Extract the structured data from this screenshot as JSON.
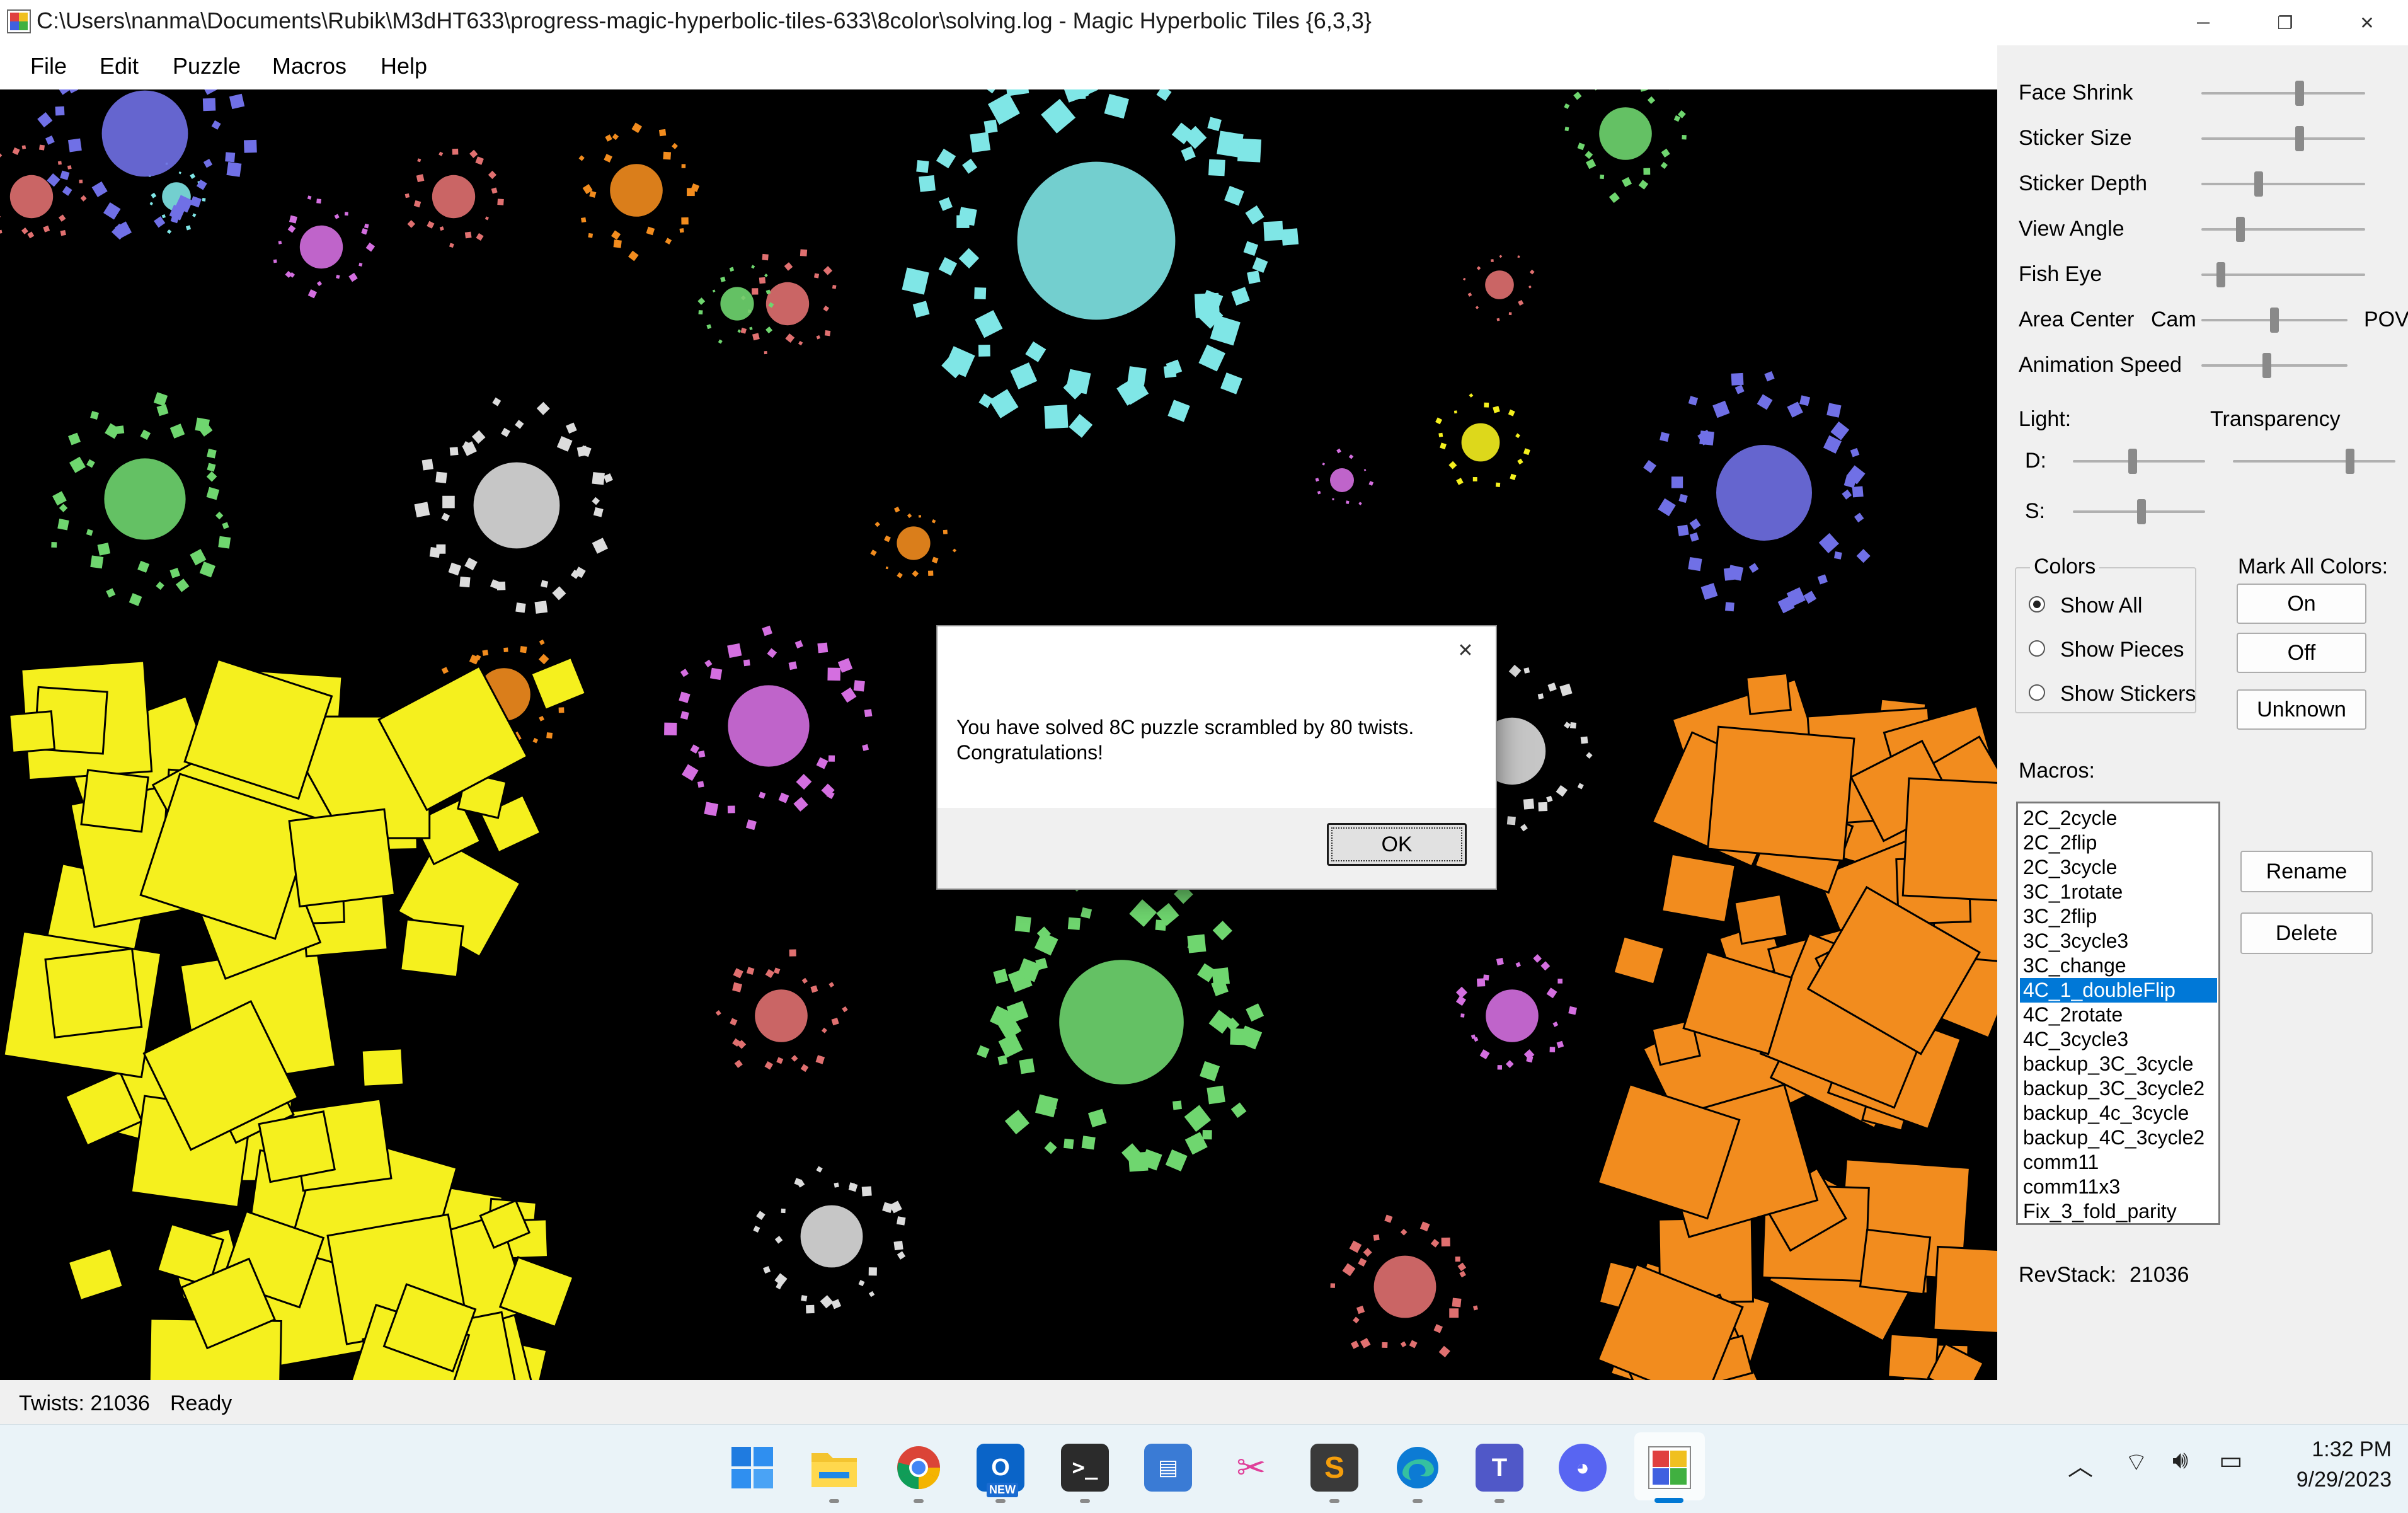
{
  "window": {
    "title": "C:\\Users\\nanma\\Documents\\Rubik\\M3dHT633\\progress-magic-hyperbolic-tiles-633\\8color\\solving.log - Magic Hyperbolic Tiles {6,3,3}",
    "minimize_glyph": "─",
    "maximize_glyph": "❐",
    "close_glyph": "✕"
  },
  "menu": {
    "file": "File",
    "edit": "Edit",
    "puzzle": "Puzzle",
    "macros": "Macros",
    "help": "Help"
  },
  "sliders": [
    {
      "label": "Face Shrink",
      "value": 0.6
    },
    {
      "label": "Sticker Size",
      "value": 0.6
    },
    {
      "label": "Sticker Depth",
      "value": 0.35
    },
    {
      "label": "View Angle",
      "value": 0.24
    },
    {
      "label": "Fish Eye",
      "value": 0.12
    },
    {
      "label": "Animation Speed",
      "value": 0.45
    }
  ],
  "area_center": {
    "label": "Area Center",
    "left": "Cam",
    "right": "POV",
    "value": 0.5
  },
  "light": {
    "label": "Light:",
    "d_label": "D:",
    "s_label": "S:",
    "d_value": 0.45,
    "s_value": 0.52
  },
  "transparency": {
    "label": "Transparency",
    "value": 0.72
  },
  "colors_group": {
    "title": "Colors",
    "options": [
      {
        "label": "Show All",
        "selected": true
      },
      {
        "label": "Show Pieces",
        "selected": false
      },
      {
        "label": "Show Stickers",
        "selected": false
      }
    ]
  },
  "mark_all_colors": {
    "title": "Mark All Colors:",
    "on": "On",
    "off": "Off",
    "unknown": "Unknown"
  },
  "macros": {
    "label": "Macros:",
    "items": [
      "2C_2cycle",
      "2C_2flip",
      "2C_3cycle",
      "3C_1rotate",
      "3C_2flip",
      "3C_3cycle3",
      "3C_change",
      "4C_1_doubleFlip",
      "4C_2rotate",
      "4C_3cycle3",
      "backup_3C_3cycle",
      "backup_3C_3cycle2",
      "backup_4c_3cycle",
      "backup_4C_3cycle2",
      "comm11",
      "comm11x3",
      "Fix_3_fold_parity"
    ],
    "selected": "4C_1_doubleFlip",
    "rename": "Rename",
    "delete": "Delete"
  },
  "revstack": {
    "label": "RevStack:",
    "value": "21036"
  },
  "status": {
    "twists": "Twists: 21036",
    "state": "Ready"
  },
  "dialog": {
    "close_glyph": "✕",
    "line1": "You have solved 8C puzzle scrambled by 80 twists.",
    "line2": "Congratulations!",
    "ok": "OK"
  },
  "taskbar": {
    "clock_time": "1:32 PM",
    "clock_date": "9/29/2023",
    "apps": [
      "windows-start",
      "file-explorer",
      "chrome",
      "outlook",
      "terminal",
      "remote-desktop",
      "snipping-tool",
      "sublime-text",
      "edge",
      "teams",
      "discord",
      "magic-hyperbolic-tiles"
    ],
    "new_badge": "NEW"
  },
  "colors": {
    "cyan": "#7fe6e6",
    "yellow": "#f5f01e",
    "orange": "#f28c1e",
    "green": "#6fd66f",
    "white": "#dcdcdc",
    "violet": "#d46fe0",
    "salmon": "#e07070",
    "blue": "#7070e6",
    "selection": "#0078d7"
  }
}
